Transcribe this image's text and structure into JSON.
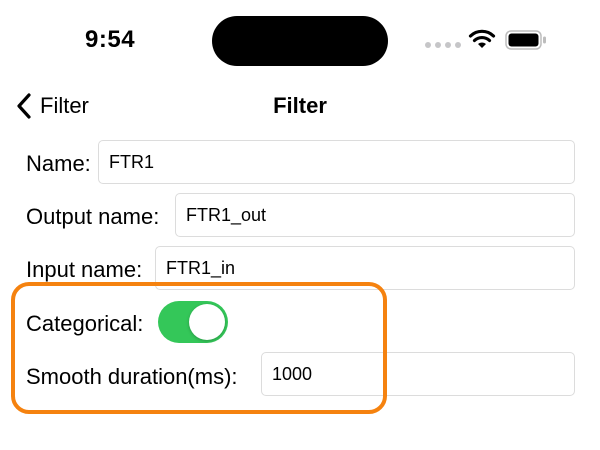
{
  "status_bar": {
    "time": "9:54"
  },
  "nav": {
    "back_label": "Filter",
    "title": "Filter"
  },
  "form": {
    "name": {
      "label": "Name:",
      "value": "FTR1"
    },
    "output_name": {
      "label": "Output name:",
      "value": "FTR1_out"
    },
    "input_name": {
      "label": "Input name:",
      "value": "FTR1_in"
    },
    "categorical": {
      "label": "Categorical:",
      "on": true
    },
    "smooth_duration": {
      "label": "Smooth duration(ms):",
      "value": "1000"
    }
  },
  "colors": {
    "toggle_on": "#34c759",
    "highlight": "#f5820f",
    "field_border": "#dcdcdc"
  },
  "icons": [
    "wifi-icon",
    "battery-icon",
    "cellular-signal-icon",
    "chevron-left-icon"
  ]
}
